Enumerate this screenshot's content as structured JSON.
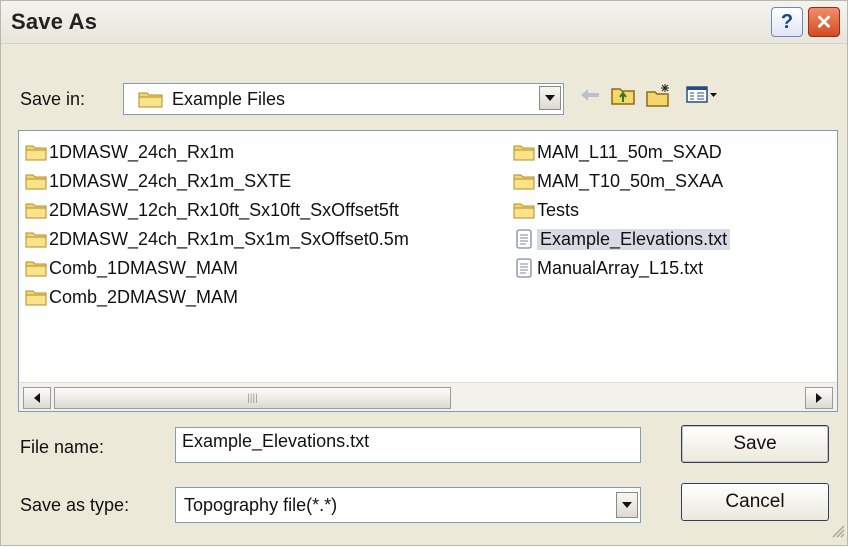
{
  "window": {
    "title": "Save As"
  },
  "save_in": {
    "label": "Save in:",
    "value": "Example Files"
  },
  "toolbar": {
    "icons": [
      "back-arrow-icon",
      "up-one-level-icon",
      "new-folder-icon",
      "view-menu-icon"
    ]
  },
  "files": {
    "left_column": [
      {
        "name": "1DMASW_24ch_Rx1m",
        "type": "folder"
      },
      {
        "name": "1DMASW_24ch_Rx1m_SXTE",
        "type": "folder"
      },
      {
        "name": "2DMASW_12ch_Rx10ft_Sx10ft_SxOffset5ft",
        "type": "folder"
      },
      {
        "name": "2DMASW_24ch_Rx1m_Sx1m_SxOffset0.5m",
        "type": "folder"
      },
      {
        "name": "Comb_1DMASW_MAM",
        "type": "folder"
      },
      {
        "name": "Comb_2DMASW_MAM",
        "type": "folder"
      }
    ],
    "right_column": [
      {
        "name": "MAM_L11_50m_SXAD",
        "type": "folder"
      },
      {
        "name": "MAM_T10_50m_SXAA",
        "type": "folder"
      },
      {
        "name": "Tests",
        "type": "folder"
      },
      {
        "name": "Example_Elevations.txt",
        "type": "text",
        "selected": true
      },
      {
        "name": "ManualArray_L15.txt",
        "type": "text"
      }
    ]
  },
  "file_name": {
    "label": "File name:",
    "value": "Example_Elevations.txt"
  },
  "save_as_type": {
    "label": "Save as type:",
    "value": "Topography file(*.*)"
  },
  "buttons": {
    "save": "Save",
    "cancel": "Cancel",
    "help": "?",
    "close": "✕"
  },
  "colors": {
    "dialog_bg": "#ece9d8",
    "selection": "#d8dbe5",
    "folder_yellow": "#f5d66b",
    "close_red": "#d24b22"
  }
}
